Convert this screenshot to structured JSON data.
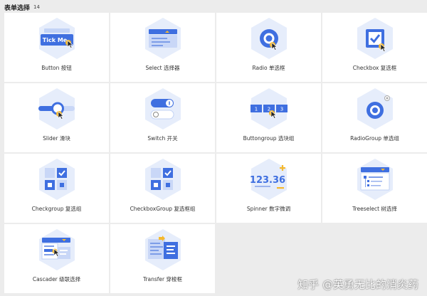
{
  "header": {
    "title": "表单选择",
    "count": "14"
  },
  "cards": [
    {
      "label": "Button 按钮",
      "icon": "button-icon",
      "text": "Tick Me"
    },
    {
      "label": "Select 选择器",
      "icon": "select-icon"
    },
    {
      "label": "Radio 单选框",
      "icon": "radio-icon"
    },
    {
      "label": "Checkbox 复选框",
      "icon": "checkbox-icon"
    },
    {
      "label": "Slider 滑块",
      "icon": "slider-icon"
    },
    {
      "label": "Switch 开关",
      "icon": "switch-icon"
    },
    {
      "label": "Buttongroup 选块组",
      "icon": "buttongroup-icon",
      "digits": [
        "1",
        "2",
        "3"
      ]
    },
    {
      "label": "RadioGroup 单选组",
      "icon": "radiogroup-icon"
    },
    {
      "label": "Checkgroup 复选组",
      "icon": "checkgroup-icon"
    },
    {
      "label": "CheckboxGroup 复选框组",
      "icon": "checkboxgroup-icon"
    },
    {
      "label": "Spinner 数字微调",
      "icon": "spinner-icon",
      "number": "123.36"
    },
    {
      "label": "Treeselect 树选择",
      "icon": "treeselect-icon"
    },
    {
      "label": "Cascader 级联选择",
      "icon": "cascader-icon"
    },
    {
      "label": "Transfer 穿梭框",
      "icon": "transfer-icon"
    }
  ],
  "watermark": "知乎 @英勇无比的消炎药",
  "colors": {
    "primary": "#3f6fe0",
    "accent": "#f5b82e",
    "hex": "#e6edfb"
  }
}
